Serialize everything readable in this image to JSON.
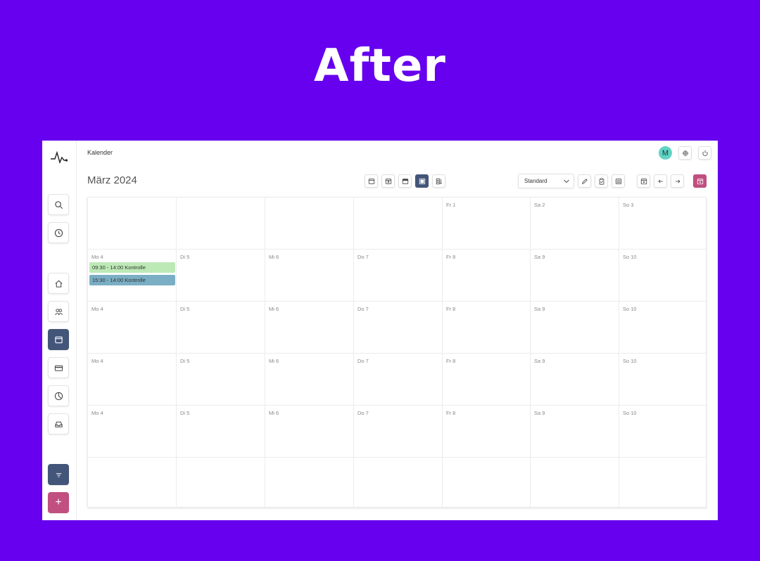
{
  "headline": "After",
  "app": {
    "page_label": "Kalender",
    "month_title": "März 2024",
    "avatar_letter": "M",
    "view_select": {
      "value": "Standard"
    },
    "colors": {
      "sidebar_active": "#44557a",
      "accent_pink": "#c14f80",
      "avatar": "#5fd4c4",
      "event_green": "#bde9b6",
      "event_blue": "#7aaec4"
    },
    "sidebar": {
      "icons": [
        "pulse-logo",
        "search-icon",
        "clock-icon",
        "home-icon",
        "users-icon",
        "calendar-icon",
        "card-icon",
        "pie-chart-icon",
        "inbox-icon",
        "filter-icon",
        "plus-icon"
      ],
      "active": "calendar-icon",
      "add_label": "+"
    },
    "toolbar": {
      "view_buttons": [
        "day-view-icon",
        "week-view-icon",
        "two-weeks-view-icon",
        "month-view-icon",
        "list-view-icon"
      ],
      "active_view": "month-view-icon",
      "actions": [
        "pencil-icon",
        "clipboard-icon",
        "list-icon"
      ],
      "nav": [
        "today-icon",
        "prev-arrow-icon",
        "next-arrow-icon",
        "calendar-add-icon"
      ]
    }
  },
  "calendar": {
    "weeks": [
      [
        "",
        "",
        "",
        "",
        "Fr 1",
        "Sa 2",
        "So 3"
      ],
      [
        "Mo 4",
        "Di 5",
        "Mi 6",
        "Do 7",
        "Fr 8",
        "Sa 9",
        "So 10"
      ],
      [
        "Mo 4",
        "Di 5",
        "Mi 6",
        "Do 7",
        "Fr 8",
        "Sa 9",
        "So 10"
      ],
      [
        "Mo 4",
        "Di 5",
        "Mi 6",
        "Do 7",
        "Fr 8",
        "Sa 9",
        "So 10"
      ],
      [
        "Mo 4",
        "Di 5",
        "Mi 6",
        "Do 7",
        "Fr 8",
        "Sa 9",
        "So 10"
      ],
      [
        "",
        "",
        "",
        "",
        "",
        "",
        ""
      ]
    ],
    "events": [
      {
        "week": 1,
        "day": 0,
        "label": "09:30 - 14:00 Kontrolle",
        "color": "#bde9b6"
      },
      {
        "week": 1,
        "day": 0,
        "label": "15:30 - 14:00 Kontrolle",
        "color": "#7aaec4"
      }
    ]
  }
}
